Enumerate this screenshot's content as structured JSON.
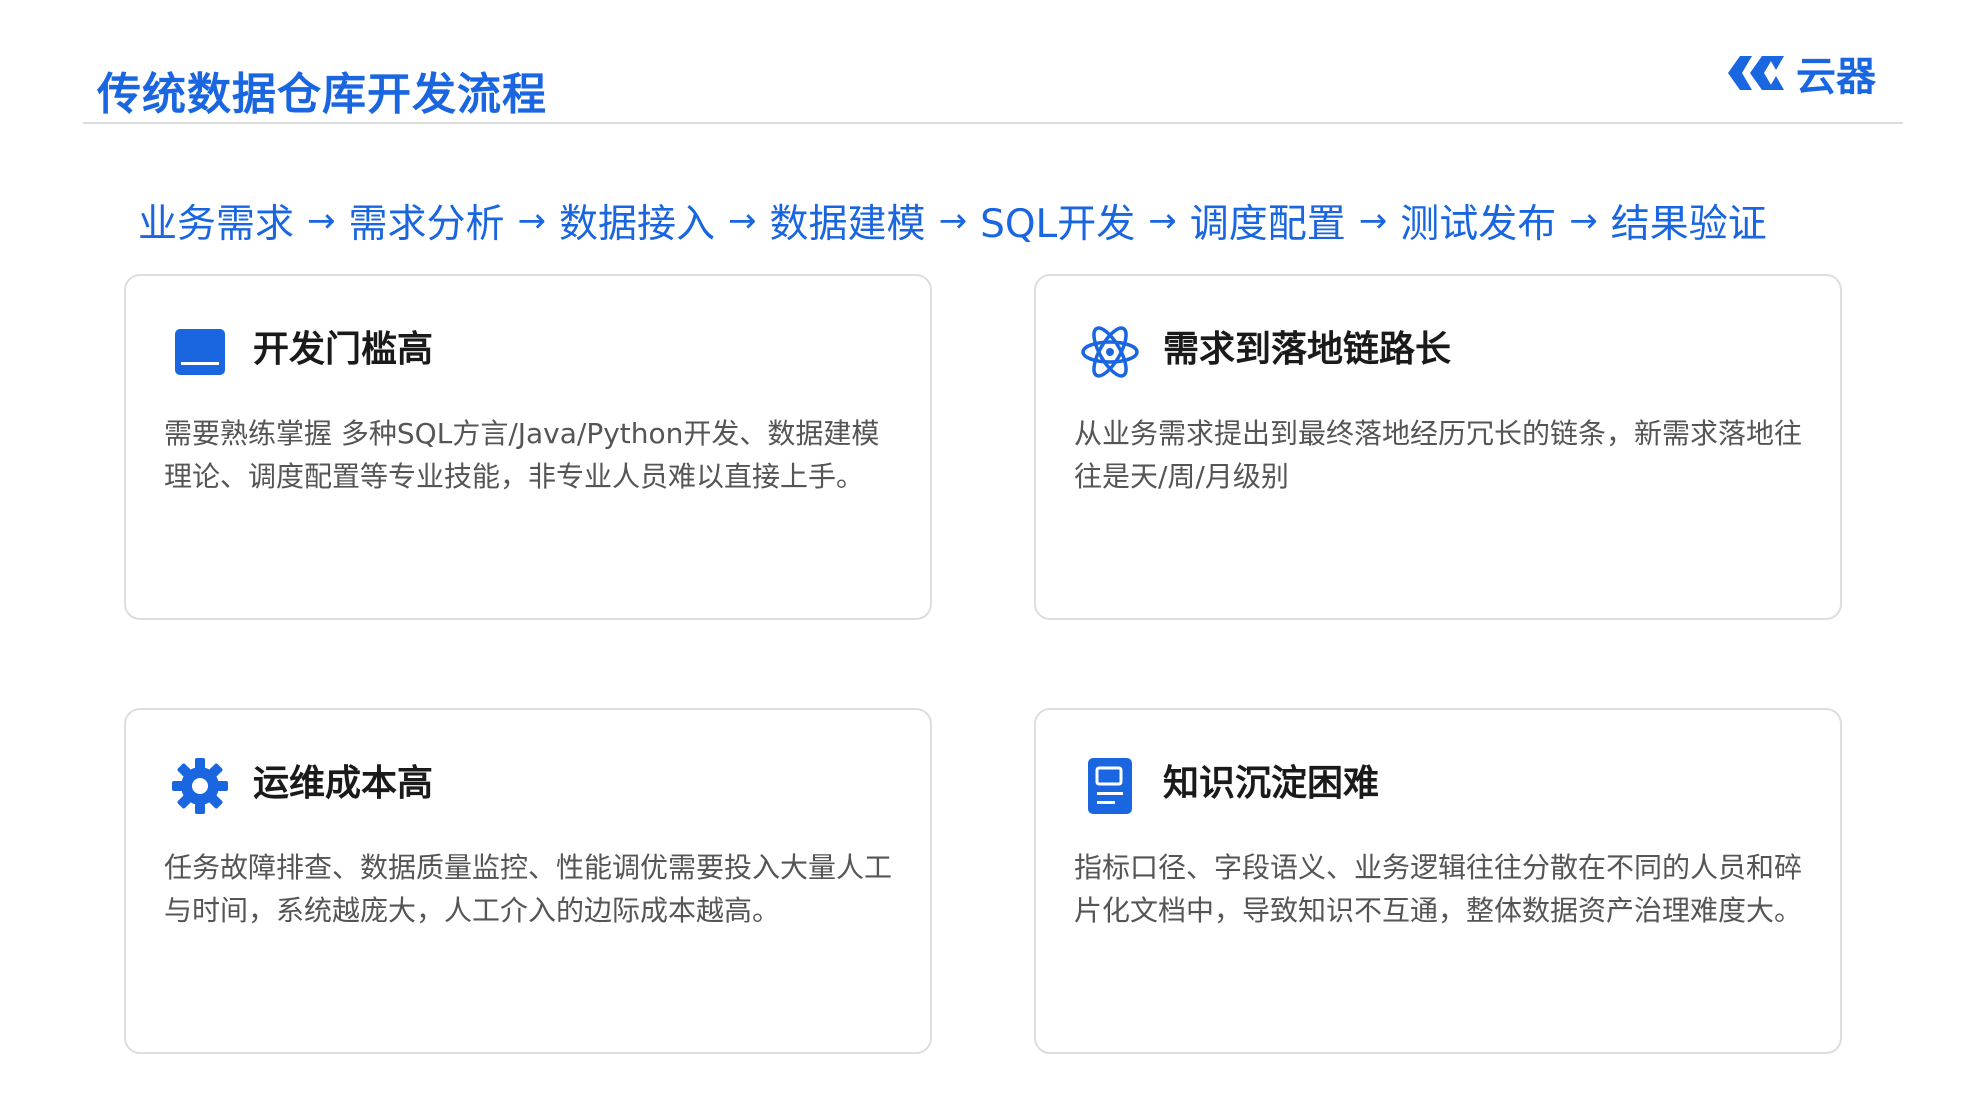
{
  "header": {
    "title": "传统数据仓库开发流程",
    "logo_text": "云器",
    "logo_icon": "cloud-qi-logo-icon"
  },
  "flow": {
    "steps": [
      "业务需求",
      "需求分析",
      "数据接入",
      "数据建模",
      "SQL开发",
      "调度配置",
      "测试发布",
      "结果验证"
    ],
    "arrow": "→"
  },
  "cards": [
    {
      "icon": "laptop-icon",
      "title": "开发门槛高",
      "description": "需要熟练掌握 多种SQL方言/Java/Python开发、数据建模理论、调度配置等专业技能，非专业人员难以直接上手。"
    },
    {
      "icon": "atom-icon",
      "title": "需求到落地链路长",
      "description": "从业务需求提出到最终落地经历冗长的链条，新需求落地往往是天/周/月级别"
    },
    {
      "icon": "gear-icon",
      "title": "运维成本高",
      "description": "任务故障排查、数据质量监控、性能调优需要投入大量人工与时间，系统越庞大，人工介入的边际成本越高。"
    },
    {
      "icon": "document-icon",
      "title": "知识沉淀困难",
      "description": "指标口径、字段语义、业务逻辑往往分散在不同的人员和碎片化文档中，导致知识不互通，整体数据资产治理难度大。"
    }
  ],
  "colors": {
    "accent": "#1a66e0",
    "title_text": "#1a1a1a",
    "body_text": "#555555",
    "border": "#dedede"
  }
}
